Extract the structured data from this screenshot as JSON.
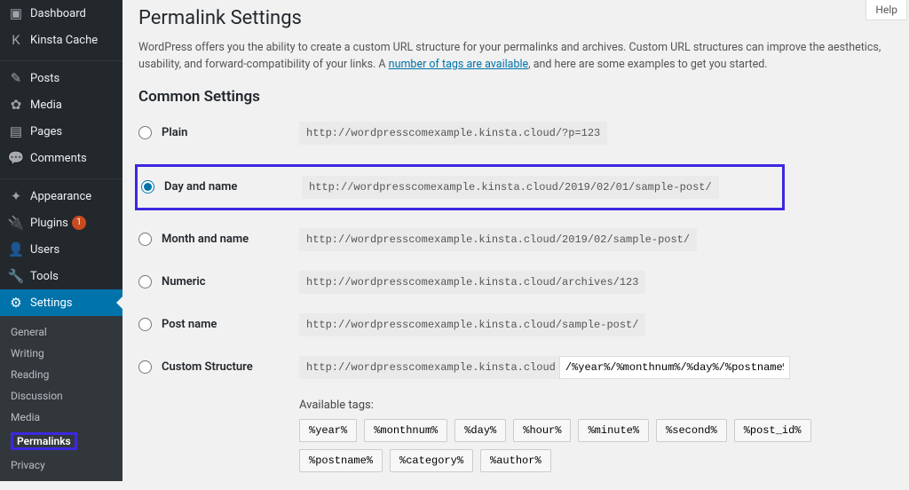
{
  "help_label": "Help",
  "sidebar": {
    "items": [
      {
        "icon": "▣",
        "label": "Dashboard"
      },
      {
        "icon": "K",
        "label": "Kinsta Cache"
      }
    ],
    "items2": [
      {
        "icon": "✎",
        "label": "Posts"
      },
      {
        "icon": "✿",
        "label": "Media"
      },
      {
        "icon": "▤",
        "label": "Pages"
      },
      {
        "icon": "💬",
        "label": "Comments"
      }
    ],
    "items3": [
      {
        "icon": "✦",
        "label": "Appearance"
      },
      {
        "icon": "🔌",
        "label": "Plugins",
        "badge": "1"
      },
      {
        "icon": "👤",
        "label": "Users"
      },
      {
        "icon": "🔧",
        "label": "Tools"
      },
      {
        "icon": "⚙",
        "label": "Settings",
        "active": true
      }
    ],
    "submenu": [
      {
        "label": "General"
      },
      {
        "label": "Writing"
      },
      {
        "label": "Reading"
      },
      {
        "label": "Discussion"
      },
      {
        "label": "Media"
      },
      {
        "label": "Permalinks",
        "current": true
      },
      {
        "label": "Privacy"
      }
    ]
  },
  "page": {
    "title": "Permalink Settings",
    "desc_pre": "WordPress offers you the ability to create a custom URL structure for your permalinks and archives. Custom URL structures can improve the aesthetics, usability, and forward-compatibility of your links. A ",
    "desc_link": "number of tags are available",
    "desc_post": ", and here are some examples to get you started.",
    "common_heading": "Common Settings",
    "options": [
      {
        "label": "Plain",
        "example": "http://wordpresscomexample.kinsta.cloud/?p=123"
      },
      {
        "label": "Day and name",
        "example": "http://wordpresscomexample.kinsta.cloud/2019/02/01/sample-post/",
        "checked": true
      },
      {
        "label": "Month and name",
        "example": "http://wordpresscomexample.kinsta.cloud/2019/02/sample-post/"
      },
      {
        "label": "Numeric",
        "example": "http://wordpresscomexample.kinsta.cloud/archives/123"
      },
      {
        "label": "Post name",
        "example": "http://wordpresscomexample.kinsta.cloud/sample-post/"
      },
      {
        "label": "Custom Structure",
        "prefix": "http://wordpresscomexample.kinsta.cloud",
        "value": "/%year%/%monthnum%/%day%/%postname%/"
      }
    ],
    "available_tags_label": "Available tags:",
    "tags": [
      "%year%",
      "%monthnum%",
      "%day%",
      "%hour%",
      "%minute%",
      "%second%",
      "%post_id%",
      "%postname%",
      "%category%",
      "%author%"
    ]
  }
}
